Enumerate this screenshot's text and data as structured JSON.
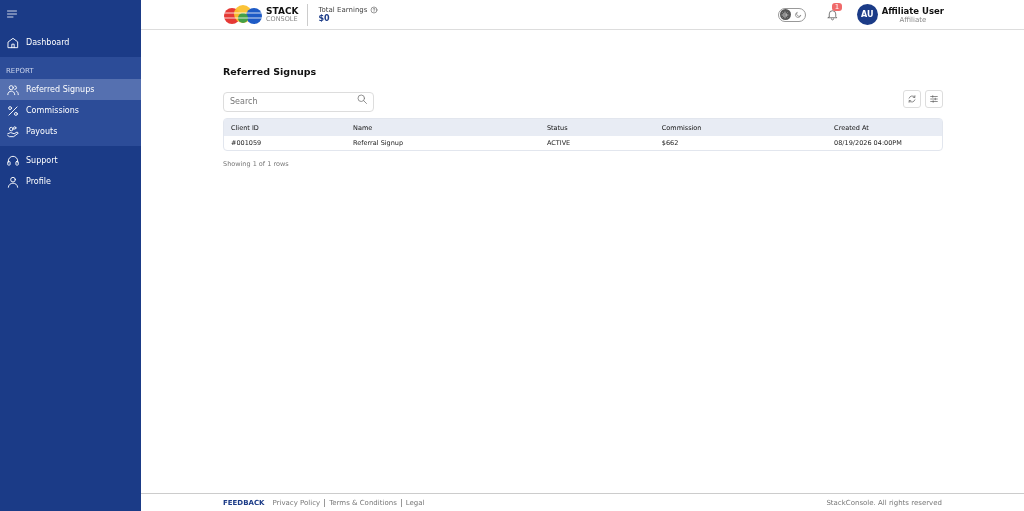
{
  "sidebar": {
    "groups": [
      {
        "items": [
          {
            "label": "Dashboard",
            "selected": false
          }
        ]
      },
      {
        "label": "REPORT",
        "items": [
          {
            "label": "Referred Signups",
            "selected": true
          },
          {
            "label": "Commissions",
            "selected": false
          },
          {
            "label": "Payouts",
            "selected": false
          }
        ]
      },
      {
        "items": [
          {
            "label": "Support",
            "selected": false
          },
          {
            "label": "Profile",
            "selected": false
          }
        ]
      }
    ]
  },
  "header": {
    "logo": {
      "title": "STACK",
      "subtitle": "CONSOLE"
    },
    "earnings": {
      "label": "Total Earnings",
      "value": "$0"
    },
    "theme_toggle": {
      "dark": false
    },
    "notifications": {
      "badge": "1"
    },
    "user": {
      "initials": "AU",
      "name": "Affiliate User",
      "role": "Affiliate"
    }
  },
  "page": {
    "title": "Referred Signups",
    "search": {
      "placeholder": "Search"
    },
    "table": {
      "columns": [
        "Client ID",
        "Name",
        "Status",
        "Commission",
        "Created At"
      ],
      "rows": [
        [
          "#001059",
          "Referral Signup",
          "ACTIVE",
          "$662",
          "08/19/2026 04:00PM"
        ]
      ]
    },
    "pagination": "Showing 1 of 1 rows"
  },
  "footer": {
    "feedback": "FEEDBACK",
    "links": [
      "Privacy Policy",
      "Terms & Conditions",
      "Legal"
    ],
    "copyright": "StackConsole. All rights reserved"
  }
}
